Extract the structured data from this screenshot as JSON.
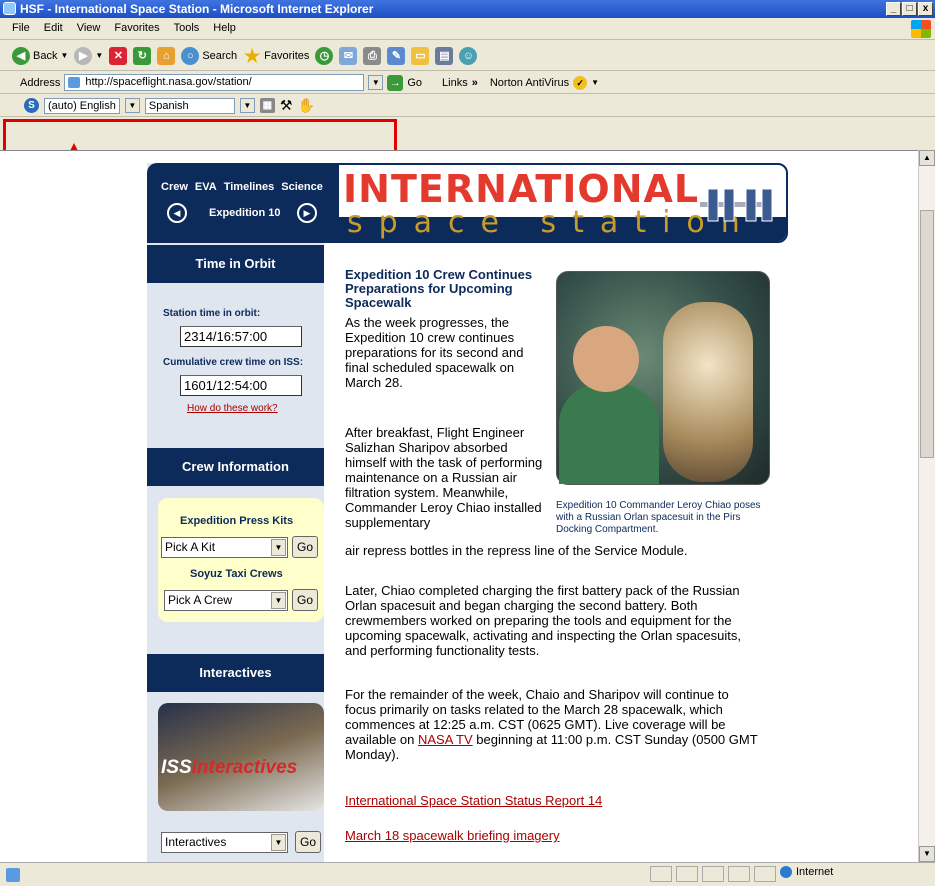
{
  "window": {
    "title": "HSF - International Space Station - Microsoft Internet Explorer",
    "min_btn": "_",
    "max_btn": "□",
    "close_btn": "x"
  },
  "menu": [
    "File",
    "Edit",
    "View",
    "Favorites",
    "Tools",
    "Help"
  ],
  "toolbar": {
    "back": "Back",
    "search": "Search",
    "favorites": "Favorites"
  },
  "address": {
    "label": "Address",
    "url": "http://spaceflight.nasa.gov/station/",
    "go": "Go",
    "links": "Links",
    "links_more": "»",
    "norton": "Norton AntiVirus"
  },
  "translate": {
    "source_lang": "(auto) English",
    "target_lang": "Spanish"
  },
  "nav": {
    "links": [
      "Crew",
      "EVA",
      "Timelines",
      "Science"
    ],
    "expedition": "Expedition 10",
    "prev": "◀",
    "next": "▶"
  },
  "banner": {
    "line1": "INTERNATIONAL",
    "line2": "space station"
  },
  "sidebar": {
    "time_heading": "Time in Orbit",
    "station_label": "Station time in orbit:",
    "station_value": "2314/16:57:00",
    "crew_label": "Cumulative crew time on ISS:",
    "crew_value": "1601/12:54:00",
    "how_link": "How do these work?",
    "crew_heading": "Crew Information",
    "press_kits_label": "Expedition Press Kits",
    "press_kits_select": "Pick A Kit",
    "soyuz_label": "Soyuz Taxi Crews",
    "soyuz_select": "Pick A Crew",
    "go": "Go",
    "interactives_heading": "Interactives",
    "interactives_logo_a": "ISS",
    "interactives_logo_b": "interactives",
    "interactives_select": "Interactives"
  },
  "article": {
    "title": "Expedition 10 Crew Continues Preparations for Upcoming Spacewalk",
    "p1": "As the week progresses, the Expedition 10 crew continues preparations for its second and final scheduled spacewalk on March 28.",
    "p2": "After breakfast, Flight Engineer Salizhan Sharipov absorbed himself with the task of performing maintenance on a Russian air filtration system. Meanwhile, Commander Leroy Chiao installed supplementary",
    "p2b": "air repress bottles in the repress line of the Service Module.",
    "p3": "Later, Chiao completed charging the first battery pack of the Russian Orlan spacesuit and began charging the second battery. Both crewmembers worked on preparing the tools and equipment for the upcoming spacewalk, activating and inspecting the Orlan spacesuits, and performing functionality tests.",
    "p4a": "For the remainder of the week, Chaio and Sharipov will continue to focus primarily on tasks related to the March 28 spacewalk, which commences at 12:25 a.m. CST (0625 GMT). Live coverage will be available on ",
    "p4link": "NASA TV",
    "p4b": " beginning at 11:00 p.m. CST Sunday (0500 GMT Monday).",
    "caption": "Expedition 10 Commander Leroy Chiao poses with a Russian Orlan spacesuit in the Pirs Docking Compartment.",
    "link1": "International Space Station Status Report 14",
    "link2": "March 18 spacewalk briefing imagery"
  },
  "status": {
    "zone": "Internet"
  }
}
